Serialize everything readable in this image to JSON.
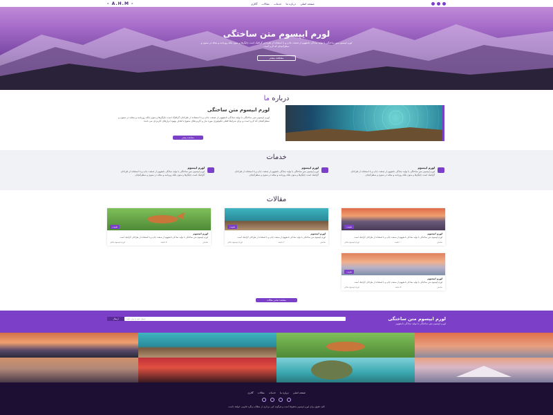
{
  "nav": {
    "logo": "- A.H.M -",
    "items": [
      "صفحه اصلی",
      "درباره ما",
      "خدمات",
      "مقالات",
      "گالری"
    ]
  },
  "hero": {
    "title": "لورم ایپسوم متن ساختگی",
    "subtitle": "لورم ایپسوم متن ساختگی با تولید سادگی نامفهوم از صنعت چاپ و با استفاده از طراحان گرافیک است چاپگرها و متون بلکه روزنامه و مجله در ستون و سطرآنچنان که لازم است",
    "button": "مشاهده بیشتر"
  },
  "about": {
    "section_title": "درباره",
    "section_title_accent": "ما",
    "heading": "لورم ایپسوم متن ساختگی",
    "paragraph": "لورم ایپسوم متن ساختگی با تولید سادگی نامفهوم از صنعت چاپ و با استفاده از طراحان گرافیک است چاپگرها و متون بلکه روزنامه و مجله در ستون و سطرآنچنان که لازم است و برای شرایط فعلی تکنولوژی مورد نیاز و کاربردهای متنوع با هدف بهبود ابزارهای کاربردی می باشد",
    "button": "مشاهده بیشتر"
  },
  "services": {
    "title": "خدمات",
    "items": [
      {
        "title": "لورم ایپسوم",
        "text": "لورم ایپسوم متن ساختگی با تولید سادگی نامفهوم از صنعت چاپ و با استفاده از طراحان گرافیک است چاپگرها و متون بلکه روزنامه و مجله در ستون و سطرآنچنان"
      },
      {
        "title": "لورم ایپسوم",
        "text": "لورم ایپسوم متن ساختگی با تولید سادگی نامفهوم از صنعت چاپ و با استفاده از طراحان گرافیک است چاپگرها و متون بلکه روزنامه و مجله در ستون و سطرآنچنان"
      },
      {
        "title": "لورم ایپسوم",
        "text": "لورم ایپسوم متن ساختگی با تولید سادگی نامفهوم از صنعت چاپ و با استفاده از طراحان گرافیک است چاپگرها و متون بلکه روزنامه و مجله در ستون و سطرآنچنان"
      }
    ]
  },
  "articles": {
    "title": "مقالات",
    "cards": [
      {
        "badge": "طبیعت",
        "title": "لورم ایپسوم",
        "text": "لورم ایپسوم متن ساختگی با تولید سادگی نامفهوم از صنعت چاپ و با استفاده از طراحان گرافیک است",
        "author": "لورم ایپسوم مثالی",
        "time": "۵ دقیقه",
        "views": "نمایش"
      },
      {
        "badge": "طبیعت",
        "title": "لورم ایپسوم",
        "text": "لورم ایپسوم متن ساختگی با تولید سادگی نامفهوم از صنعت چاپ و با استفاده از طراحان گرافیک است",
        "author": "لورم ایپسوم مثالی",
        "time": "۷ دقیقه",
        "views": "نمایش"
      },
      {
        "badge": "طبیعت",
        "title": "لورم ایپسوم",
        "text": "لورم ایپسوم متن ساختگی با تولید سادگی نامفهوم از صنعت چاپ و با استفاده از طراحان گرافیک است",
        "author": "لورم ایپسوم مثالی",
        "time": "۱۰ دقیقه",
        "views": "نمایش"
      },
      {
        "badge": "طبیعت",
        "title": "لورم ایپسوم",
        "text": "لورم ایپسوم متن ساختگی با تولید سادگی نامفهوم از صنعت چاپ و با استفاده از طراحان گرافیک است",
        "author": "لورم ایپسوم مثالی",
        "time": "۵ دقیقه",
        "views": "نمایش"
      }
    ],
    "more_button": "مشاهده تمامی مقالات"
  },
  "newsletter": {
    "title": "لورم ایپسوم متن ساختگی",
    "subtitle": "لورم ایپسوم متن ساختگی با تولید سادگی نامفهوم",
    "placeholder": "ایمیل خود را وارد کنید",
    "button": "ارسال"
  },
  "footer": {
    "items": [
      "صفحه اصلی",
      "درباره ما",
      "خدمات",
      "مقالات",
      "گالری"
    ],
    "copyright": "کلیه حقوق برای لورم ایپسوم محفوظ است و هرگونه کپی برداری از مطالب پیگرد قانونی خواهد داشت"
  },
  "colors": {
    "accent": "#7b3fc8",
    "footer": "#1c0f33",
    "services_bg": "#f0f2f5"
  }
}
